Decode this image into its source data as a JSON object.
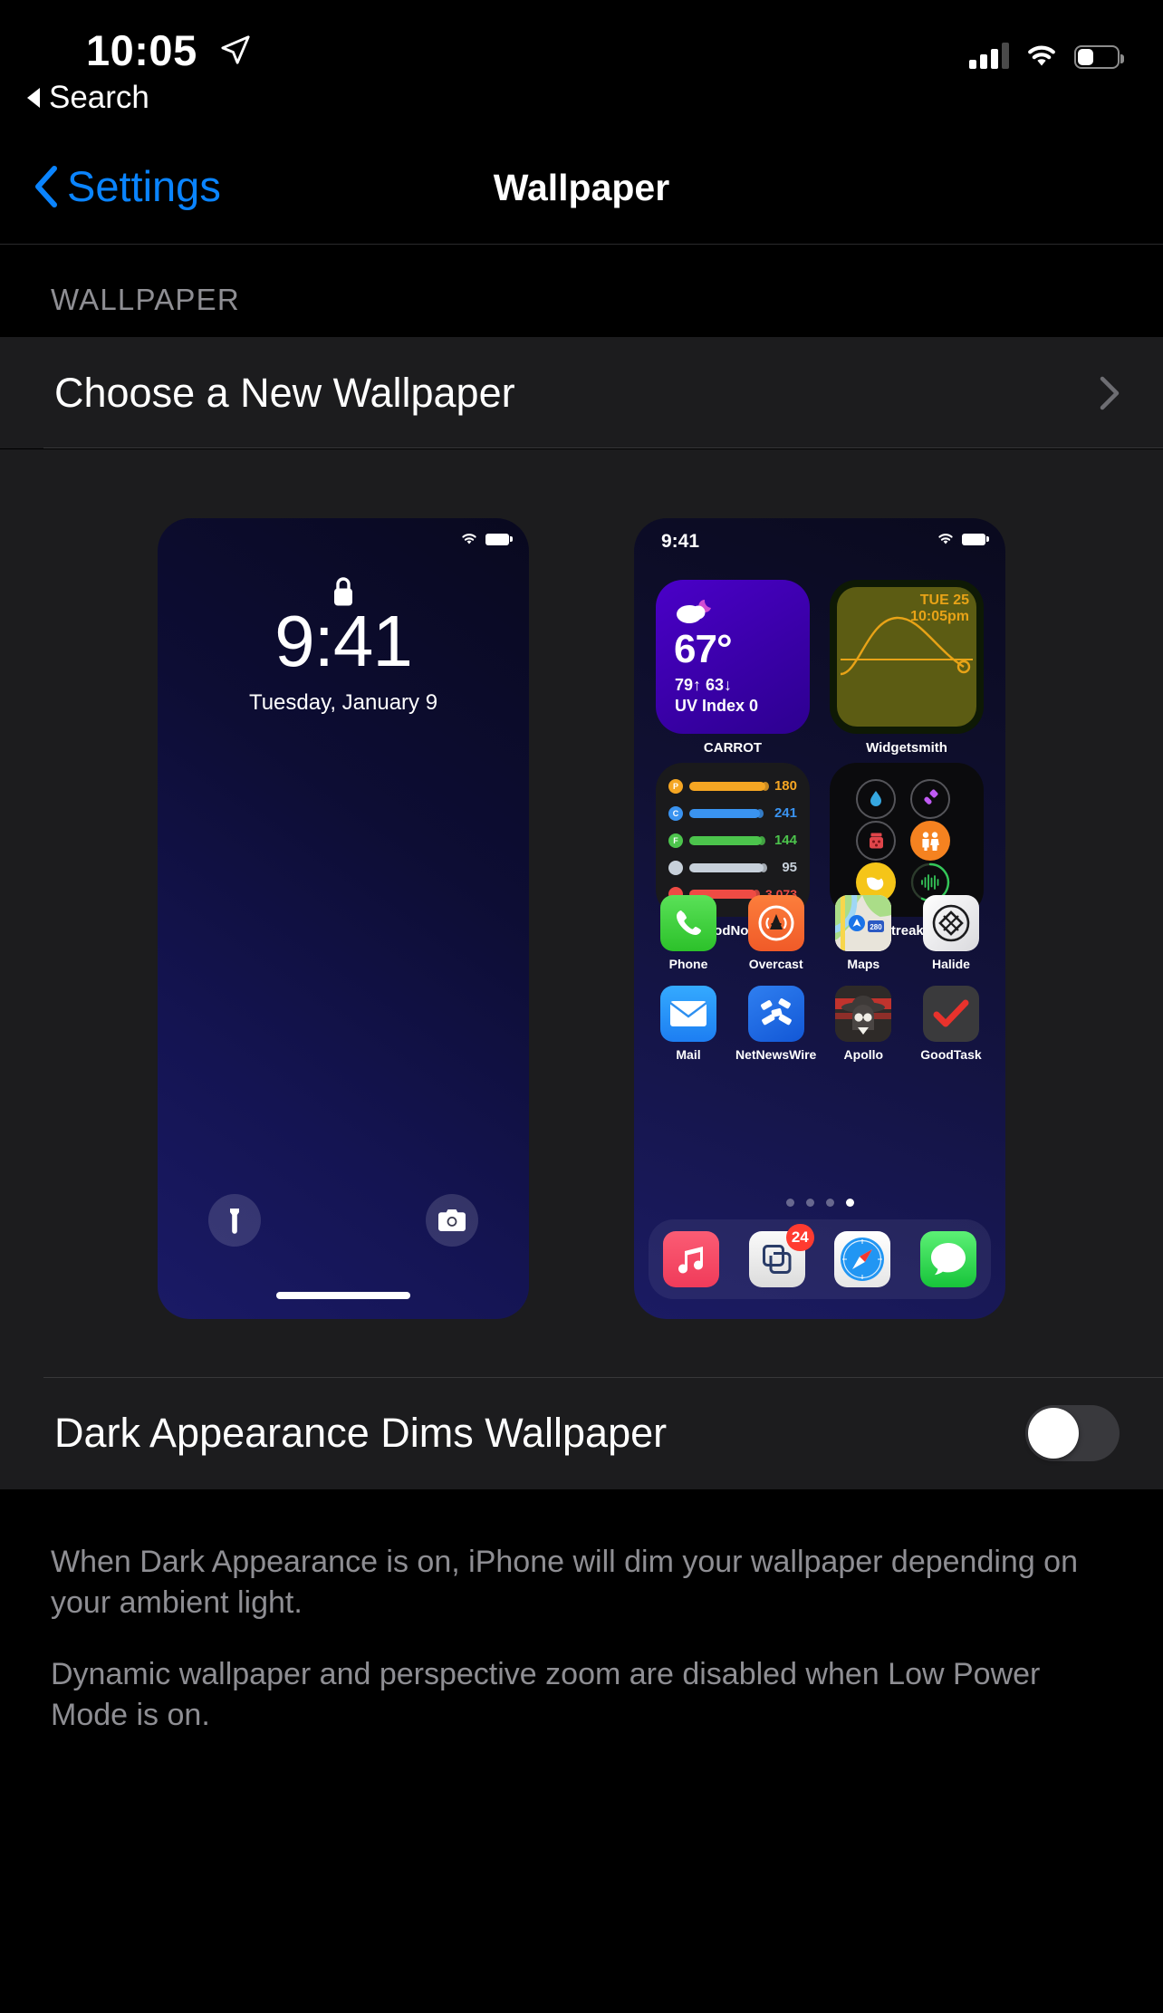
{
  "statusbar": {
    "time": "10:05",
    "location_icon": "location-arrow-icon",
    "signal_icon": "cellular-signal-icon",
    "wifi_icon": "wifi-icon",
    "battery_icon": "battery-icon",
    "battery_level_pct": 36
  },
  "search_back": {
    "label": "Search",
    "icon": "back-triangle-icon"
  },
  "navbar": {
    "back_label": "Settings",
    "back_icon": "chevron-left-icon",
    "title": "Wallpaper",
    "accent_color": "#0a84ff"
  },
  "section": {
    "header": "WALLPAPER"
  },
  "choose_row": {
    "label": "Choose a New Wallpaper",
    "chevron_icon": "chevron-right-icon"
  },
  "lock_preview": {
    "name": "lock-screen-preview",
    "status_wifi": "wifi-icon",
    "status_battery": "battery-icon",
    "lock_icon": "lock-icon",
    "time": "9:41",
    "date": "Tuesday, January 9",
    "left_button_icon": "flashlight-icon",
    "right_button_icon": "camera-icon",
    "home_indicator": "home-indicator"
  },
  "home_preview": {
    "name": "home-screen-preview",
    "status_time": "9:41",
    "status_wifi": "wifi-icon",
    "status_battery": "battery-icon",
    "widgets": [
      {
        "label": "CARROT",
        "icon": "cloud-moon-icon",
        "temp": "67°",
        "hi_lo": "79↑ 63↓",
        "uv": "UV Index 0",
        "color": "#4a00c8"
      },
      {
        "label": "Widgetsmith",
        "line1": "TUE 25",
        "line2": "10:05pm",
        "color": "#5c5c13",
        "accent": "#e8a317"
      },
      {
        "label": "FoodNoms",
        "rows": [
          {
            "key": "P",
            "value": "180",
            "color": "#f5a623"
          },
          {
            "key": "C",
            "value": "241",
            "color": "#3a93f0"
          },
          {
            "key": "F",
            "value": "144",
            "color": "#4cc44c"
          },
          {
            "key": "",
            "value": "95",
            "color": "#c7d0da"
          },
          {
            "key": "",
            "value": "3,073",
            "color": "#ef4b44"
          }
        ]
      },
      {
        "label": "Streaks",
        "cells": [
          {
            "icon": "water-drop-icon",
            "color": "#36a7e0",
            "filled": false
          },
          {
            "icon": "toothbrush-icon",
            "color": "#bf5af2",
            "filled": false
          },
          {
            "icon": "pill-jar-icon",
            "color": "#e0454a",
            "filled": false
          },
          {
            "icon": "people-icon",
            "color": "#f58220",
            "filled": true
          },
          {
            "icon": "muscle-arm-icon",
            "color": "#f5c518",
            "filled": true
          },
          {
            "icon": "waveform-icon",
            "color": "#34c759",
            "filled": false
          }
        ]
      }
    ],
    "app_rows": [
      [
        {
          "name": "Phone",
          "icon": "phone-icon"
        },
        {
          "name": "Overcast",
          "icon": "overcast-icon"
        },
        {
          "name": "Maps",
          "icon": "maps-icon"
        },
        {
          "name": "Halide",
          "icon": "halide-icon"
        }
      ],
      [
        {
          "name": "Mail",
          "icon": "mail-icon"
        },
        {
          "name": "NetNewsWire",
          "icon": "netnewswire-icon"
        },
        {
          "name": "Apollo",
          "icon": "apollo-icon"
        },
        {
          "name": "GoodTask",
          "icon": "goodtask-icon"
        }
      ]
    ],
    "page_dots": {
      "count": 4,
      "active_index": 3
    },
    "dock": [
      {
        "name": "Music",
        "icon": "music-note-icon",
        "badge": ""
      },
      {
        "name": "Tot",
        "icon": "tot-squares-icon",
        "badge": "24"
      },
      {
        "name": "Safari",
        "icon": "safari-icon",
        "badge": ""
      },
      {
        "name": "Messages",
        "icon": "messages-icon",
        "badge": ""
      }
    ]
  },
  "toggle_row": {
    "label": "Dark Appearance Dims Wallpaper",
    "state": "off"
  },
  "footer": {
    "p1": "When Dark Appearance is on, iPhone will dim your wallpaper depending on your ambient light.",
    "p2": "Dynamic wallpaper and perspective zoom are disabled when Low Power Mode is on."
  }
}
